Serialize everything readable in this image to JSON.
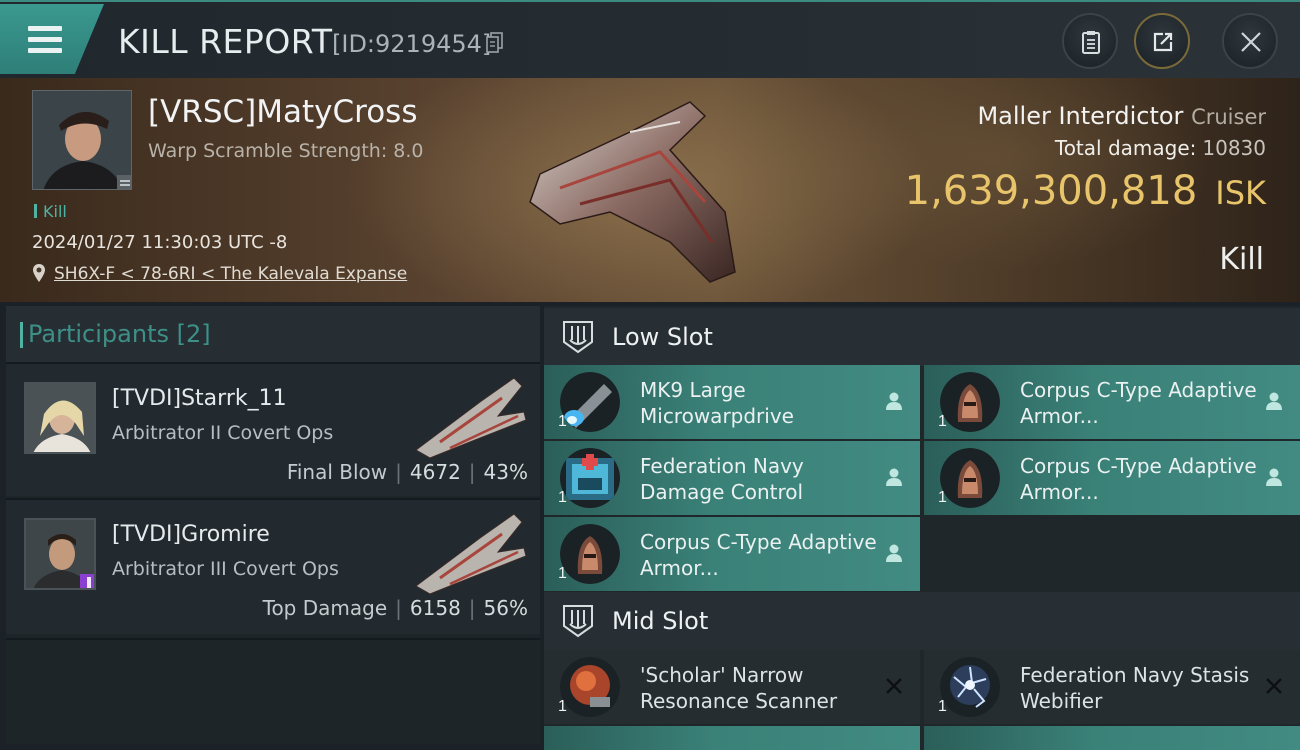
{
  "header": {
    "title": "KILL REPORT",
    "report_id": "[ID:9219454]"
  },
  "victim": {
    "pilot": "[VRSC]MatyCross",
    "subtitle": "Warp Scramble Strength: 8.0",
    "kill_tag": "Kill",
    "datetime": "2024/01/27 11:30:03 UTC -8",
    "location": "SH6X-F < 78-6RI < The Kalevala Expanse",
    "ship_name": "Maller Interdictor",
    "ship_class": "Cruiser",
    "total_damage_label": "Total damage:",
    "total_damage": "10830",
    "isk_value": "1,639,300,818",
    "isk_unit": "ISK",
    "result": "Kill"
  },
  "participants": {
    "title": "Participants [2]",
    "rows": [
      {
        "name": "[TVDI]Starrk_11",
        "ship": "Arbitrator II Covert Ops",
        "tag": "Final Blow",
        "damage": "4672",
        "percent": "43%"
      },
      {
        "name": "[TVDI]Gromire",
        "ship": "Arbitrator III Covert Ops",
        "tag": "Top Damage",
        "damage": "6158",
        "percent": "56%"
      }
    ]
  },
  "slots": {
    "low": {
      "title": "Low Slot",
      "items": [
        {
          "name": "MK9 Large Microwarpdrive",
          "qty": "1",
          "state": "dropped"
        },
        {
          "name": "Corpus C-Type Adaptive Armor...",
          "qty": "1",
          "state": "dropped"
        },
        {
          "name": "Federation Navy Damage Control",
          "qty": "1",
          "state": "dropped"
        },
        {
          "name": "Corpus C-Type Adaptive Armor...",
          "qty": "1",
          "state": "dropped"
        },
        {
          "name": "Corpus C-Type Adaptive Armor...",
          "qty": "1",
          "state": "dropped"
        }
      ]
    },
    "mid": {
      "title": "Mid Slot",
      "items": [
        {
          "name": "'Scholar' Narrow Resonance Scanner",
          "qty": "1",
          "state": "destroyed"
        },
        {
          "name": "Federation Navy Stasis Webifier",
          "qty": "1",
          "state": "destroyed"
        }
      ]
    }
  },
  "colors": {
    "accent_teal": "#3a8178",
    "isk_gold": "#e8c46a",
    "kill_tag": "#4fb3a4"
  },
  "icons": {
    "menu": "hamburger-menu-icon",
    "copy": "copy-icon",
    "clipboard": "clipboard-icon",
    "share": "share-icon",
    "close": "close-icon",
    "location": "location-pin-icon",
    "slot": "slot-icon",
    "dropped": "person-icon",
    "destroyed": "x-icon"
  }
}
